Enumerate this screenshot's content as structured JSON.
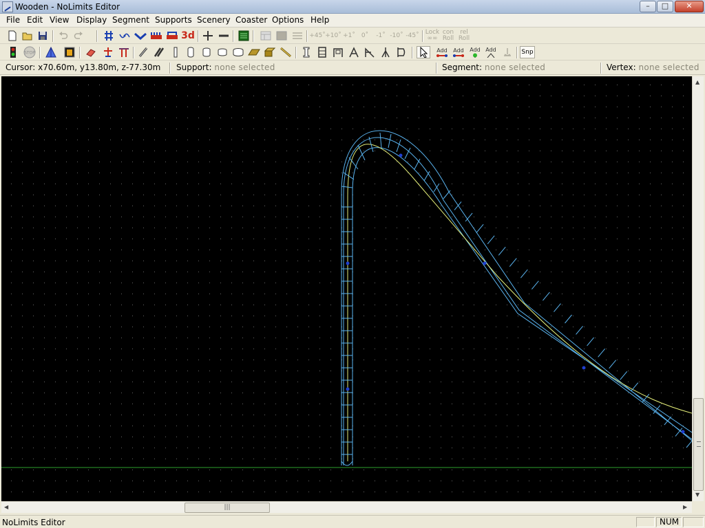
{
  "window": {
    "title": "Wooden - NoLimits Editor",
    "minimize": "–",
    "maximize": "□",
    "close": "✕"
  },
  "menu": [
    "File",
    "Edit",
    "View",
    "Display",
    "Segment",
    "Supports",
    "Scenery",
    "Coaster",
    "Options",
    "Help"
  ],
  "toolbar1": {
    "threed_label": "3d",
    "rot_plus45": "+45˚",
    "rot_plus10": "+10˚",
    "rot_plus1": "+1˚",
    "rot_zero": "0˚",
    "rot_minus1": "-1˚",
    "rot_minus10": "-10˚",
    "rot_minus45": "-45˚",
    "lock_label_1": "Lock",
    "lock_label_2": "∞∞",
    "con_roll_1": "con",
    "con_roll_2": "Roll",
    "rel_roll_1": "rel",
    "rel_roll_2": "Roll"
  },
  "toolbar2": {
    "stop_label": "STOP",
    "add_label": "Add",
    "snap_label": "Snp"
  },
  "coords": {
    "cursor_label": "Cursor:",
    "cursor_value": "x70.60m, y13.80m, z-77.30m",
    "support_label": "Support:",
    "support_value": "none selected",
    "segment_label": "Segment:",
    "segment_value": "none selected",
    "vertex_label": "Vertex:",
    "vertex_value": "none selected"
  },
  "status": {
    "text": "NoLimits Editor",
    "num": "NUM"
  },
  "colors": {
    "track": "#5ab4f0",
    "spline": "#e6f07a",
    "ground": "#2ea02e",
    "grid_dot": "#6a6a6a",
    "node": "#1f3fd0"
  }
}
